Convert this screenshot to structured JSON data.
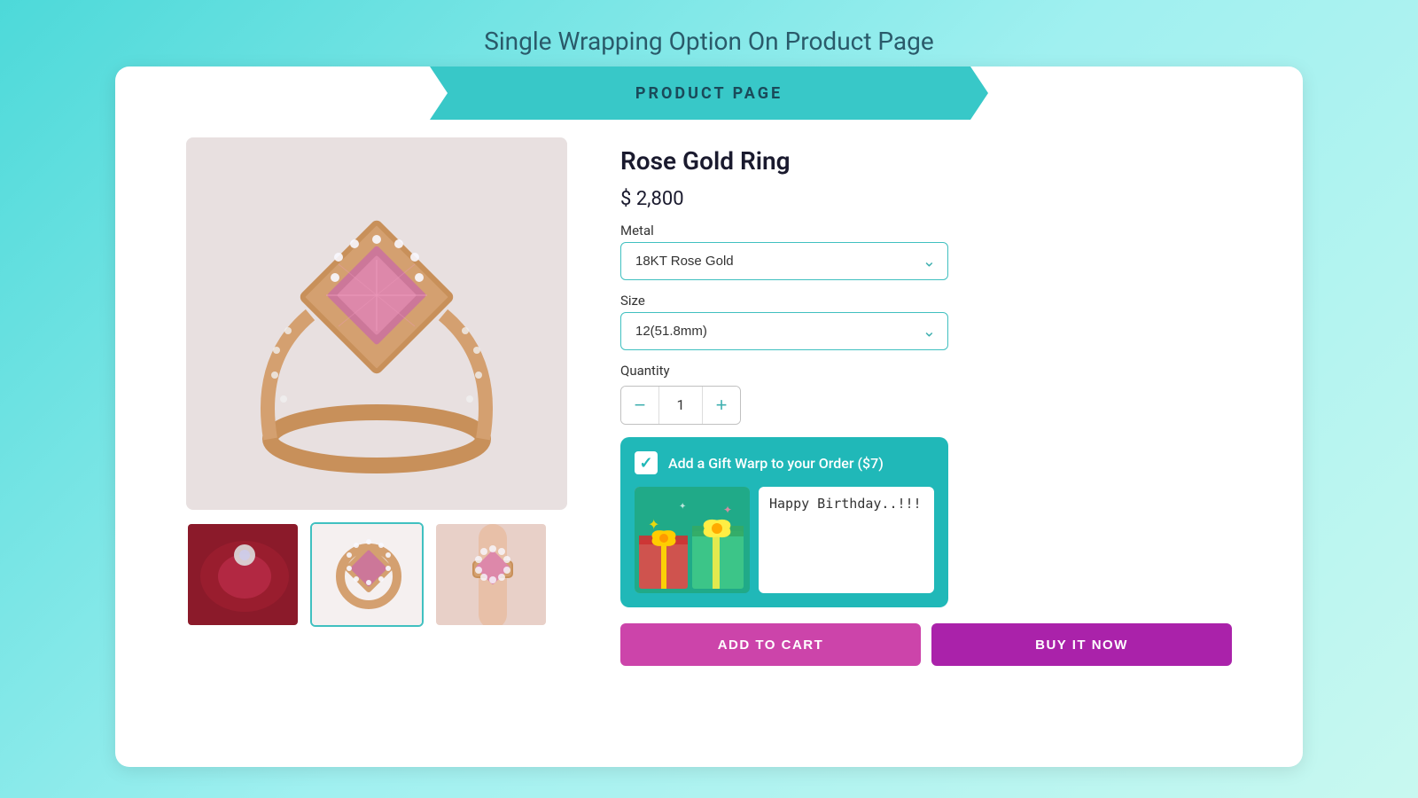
{
  "page": {
    "title": "Single Wrapping Option On Product Page"
  },
  "banner": {
    "text": "PRODUCT PAGE"
  },
  "product": {
    "title": "Rose Gold Ring",
    "price": "$ 2,800",
    "metal_label": "Metal",
    "metal_value": "18KT Rose Gold",
    "size_label": "Size",
    "size_value": "12(51.8mm)",
    "quantity_label": "Quantity",
    "quantity_value": "1"
  },
  "gift_wrap": {
    "label": "Add a Gift Warp to your Order ($7)",
    "message_placeholder": "Happy Birthday..!!!",
    "message_value": "Happy Birthday..!!!"
  },
  "buttons": {
    "add_to_cart": "ADD TO CART",
    "buy_now": "BUY IT NOW"
  },
  "thumbnails": [
    {
      "alt": "thumbnail-1-gift-fabric"
    },
    {
      "alt": "thumbnail-2-ring-top",
      "active": true
    },
    {
      "alt": "thumbnail-3-ring-hand"
    }
  ]
}
